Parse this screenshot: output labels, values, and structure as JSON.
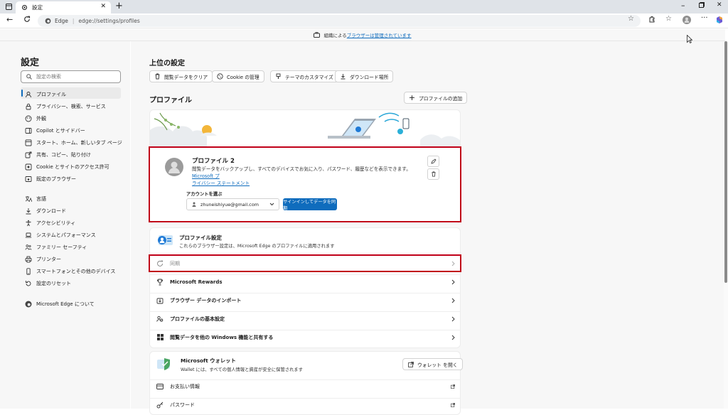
{
  "tab": {
    "title": "設定"
  },
  "address": {
    "site_label": "Edge",
    "url": "edge://settings/profiles"
  },
  "infobar": {
    "prefix": "組織による",
    "link": "ブラウザーは管理されています"
  },
  "sidebar": {
    "title": "設定",
    "search_placeholder": "設定の検索",
    "items": [
      {
        "label": "プロファイル",
        "icon": "profile-icon",
        "active": true
      },
      {
        "label": "プライバシー、検索、サービス",
        "icon": "lock-icon"
      },
      {
        "label": "外観",
        "icon": "appearance-icon"
      },
      {
        "label": "Copilot とサイドバー",
        "icon": "sidebar-icon"
      },
      {
        "label": "スタート、ホーム、新しいタブ ページ",
        "icon": "home-icon"
      },
      {
        "label": "共有、コピー、貼り付け",
        "icon": "share-icon"
      },
      {
        "label": "Cookie とサイトのアクセス許可",
        "icon": "cookie-icon"
      },
      {
        "label": "既定のブラウザー",
        "icon": "browser-icon"
      },
      {
        "label": "言語",
        "icon": "language-icon"
      },
      {
        "label": "ダウンロード",
        "icon": "download-icon"
      },
      {
        "label": "アクセシビリティ",
        "icon": "accessibility-icon"
      },
      {
        "label": "システムとパフォーマンス",
        "icon": "laptop-icon"
      },
      {
        "label": "ファミリー セーフティ",
        "icon": "family-icon"
      },
      {
        "label": "プリンター",
        "icon": "printer-icon"
      },
      {
        "label": "スマートフォンとその他のデバイス",
        "icon": "phone-icon"
      },
      {
        "label": "設定のリセット",
        "icon": "reset-icon"
      },
      {
        "label": "Microsoft Edge について",
        "icon": "edge-icon"
      }
    ]
  },
  "top_settings": {
    "title": "上位の設定",
    "buttons": [
      {
        "label": "閲覧データをクリア",
        "icon": "trash-icon"
      },
      {
        "label": "Cookie の管理",
        "icon": "cookie-icon"
      },
      {
        "label": "テーマのカスタマイズ",
        "icon": "brush-icon"
      },
      {
        "label": "ダウンロード場所",
        "icon": "download-icon"
      }
    ]
  },
  "profiles": {
    "title": "プロファイル",
    "add_button": "プロファイルの追加",
    "profile_name": "プロファイル 2",
    "description": "閲覧データをバックアップし、すべてのデバイスでお気に入り、パスワード、履歴などを表示できます。",
    "privacy_link_a": "Microsoft プ",
    "privacy_link_b": "ライバシー ステートメント",
    "account_label": "アカウントを選ぶ",
    "account_value": "zhuneishiyue@gmail.com",
    "signin_button": "サインインしてデータを同期"
  },
  "profile_settings": {
    "title": "プロファイル設定",
    "subtitle": "これらのブラウザー設定は、Microsoft Edge のプロファイルに適用されます"
  },
  "rows": [
    {
      "label": "同期",
      "icon": "sync-icon",
      "disabled": true
    },
    {
      "label": "Microsoft Rewards",
      "icon": "trophy-icon"
    },
    {
      "label": "ブラウザー データのインポート",
      "icon": "import-icon"
    },
    {
      "label": "プロファイルの基本設定",
      "icon": "people-icon"
    },
    {
      "label": "閲覧データを他の Windows 機能と共有する",
      "icon": "windows-icon"
    }
  ],
  "wallet": {
    "title": "Microsoft ウォレット",
    "subtitle": "Wallet には、すべての個人情報と資産が安全に保管されます",
    "open_button": "ウォレット を開く",
    "payment": "お支払い情報",
    "password": "パスワード"
  },
  "colors": {
    "accent": "#0f6cbd",
    "highlight": "#c00018"
  }
}
